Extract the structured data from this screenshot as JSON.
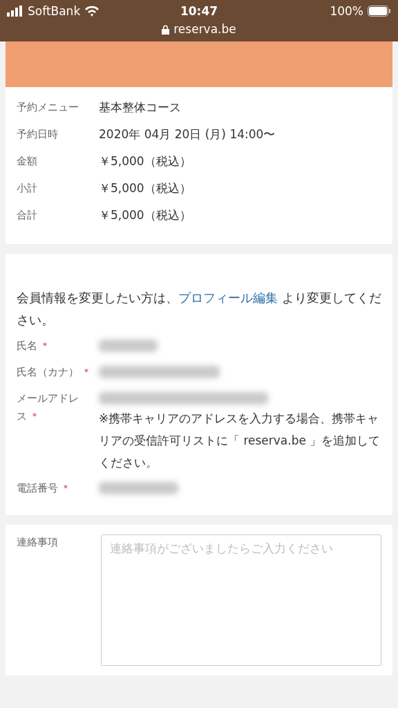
{
  "status_bar": {
    "carrier": "SoftBank",
    "time": "10:47",
    "battery": "100%",
    "url": "reserva.be"
  },
  "summary": [
    {
      "label": "予約メニュー",
      "value": "基本整体コース"
    },
    {
      "label": "予約日時",
      "value": "2020年 04月 20日 (月) 14:00〜"
    },
    {
      "label": "金額",
      "value": "￥5,000（税込）"
    },
    {
      "label": "小計",
      "value": "￥5,000（税込）"
    },
    {
      "label": "合計",
      "value": "￥5,000（税込）"
    }
  ],
  "member": {
    "intro_before": "会員情報を変更したい方は、",
    "intro_link": "プロフィール編集",
    "intro_after": "より変更してください。",
    "required_mark": "*",
    "fields": [
      {
        "label": "氏名",
        "required": true,
        "redacted": true
      },
      {
        "label": "氏名（カナ）",
        "required": true,
        "redacted": true
      },
      {
        "label": "メールアドレス",
        "required": true,
        "redacted": true,
        "note": "※携帯キャリアのアドレスを入力する場合、携帯キャリアの受信許可リストに「 reserva.be 」を追加してください。"
      },
      {
        "label": "電話番号",
        "required": true,
        "redacted": true
      }
    ]
  },
  "contact": {
    "label": "連絡事項",
    "placeholder": "連絡事項がございましたらご入力ください"
  }
}
